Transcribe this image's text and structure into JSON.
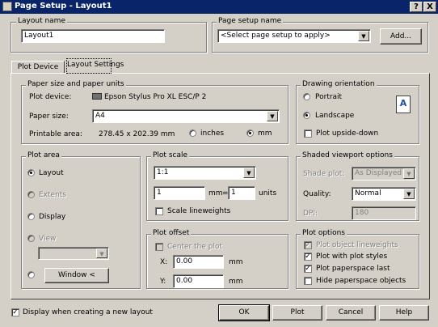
{
  "window": {
    "title": "Page Setup - Layout1",
    "help_btn": "?",
    "close_btn": "X"
  },
  "layout_name": {
    "label": "Layout name",
    "value": "Layout1"
  },
  "page_setup_name": {
    "label": "Page setup name",
    "value": "<Select page setup to apply>",
    "add_button": "Add..."
  },
  "tabs": [
    {
      "label": "Plot Device"
    },
    {
      "label": "Layout Settings"
    }
  ],
  "paper": {
    "label": "Paper size and paper units",
    "plot_device_label": "Plot device:",
    "plot_device_value": "Epson Stylus Pro XL ESC/P 2",
    "paper_size_label": "Paper size:",
    "paper_size_value": "A4",
    "printable_label": "Printable area:",
    "printable_value": "278.45 x 202.39 mm",
    "inches": "inches",
    "mm": "mm"
  },
  "orientation": {
    "label": "Drawing orientation",
    "portrait": "Portrait",
    "landscape": "Landscape",
    "upside_down": "Plot upside-down",
    "icon_letter": "A"
  },
  "plot_area": {
    "label": "Plot area",
    "layout": "Layout",
    "extents": "Extents",
    "display": "Display",
    "view": "View",
    "window_button": "Window <"
  },
  "plot_scale": {
    "label": "Plot scale",
    "scale_value": "1:1",
    "mm_value": "1",
    "mm_label": "mm",
    "eq": "=",
    "units_value": "1",
    "units_label": "units",
    "scale_lineweights": "Scale lineweights"
  },
  "plot_offset": {
    "label": "Plot offset",
    "center": "Center the plot",
    "x_label": "X:",
    "x_value": "0.00",
    "x_unit": "mm",
    "y_label": "Y:",
    "y_value": "0.00",
    "y_unit": "mm"
  },
  "shaded": {
    "label": "Shaded viewport options",
    "shade_label": "Shade plot:",
    "shade_value": "As Displayed",
    "quality_label": "Quality:",
    "quality_value": "Normal",
    "dpi_label": "DPI:",
    "dpi_value": "180"
  },
  "plot_options": {
    "label": "Plot options",
    "lineweights": "Plot object lineweights",
    "styles": "Plot with plot styles",
    "paperspace_last": "Plot paperspace last",
    "hide": "Hide paperspace objects"
  },
  "footer": {
    "display_new": "Display when creating a new layout",
    "ok": "OK",
    "plot": "Plot",
    "cancel": "Cancel",
    "help": "Help"
  },
  "colors": {
    "titlebar": "#0a246a",
    "face": "#d4d0c8"
  }
}
